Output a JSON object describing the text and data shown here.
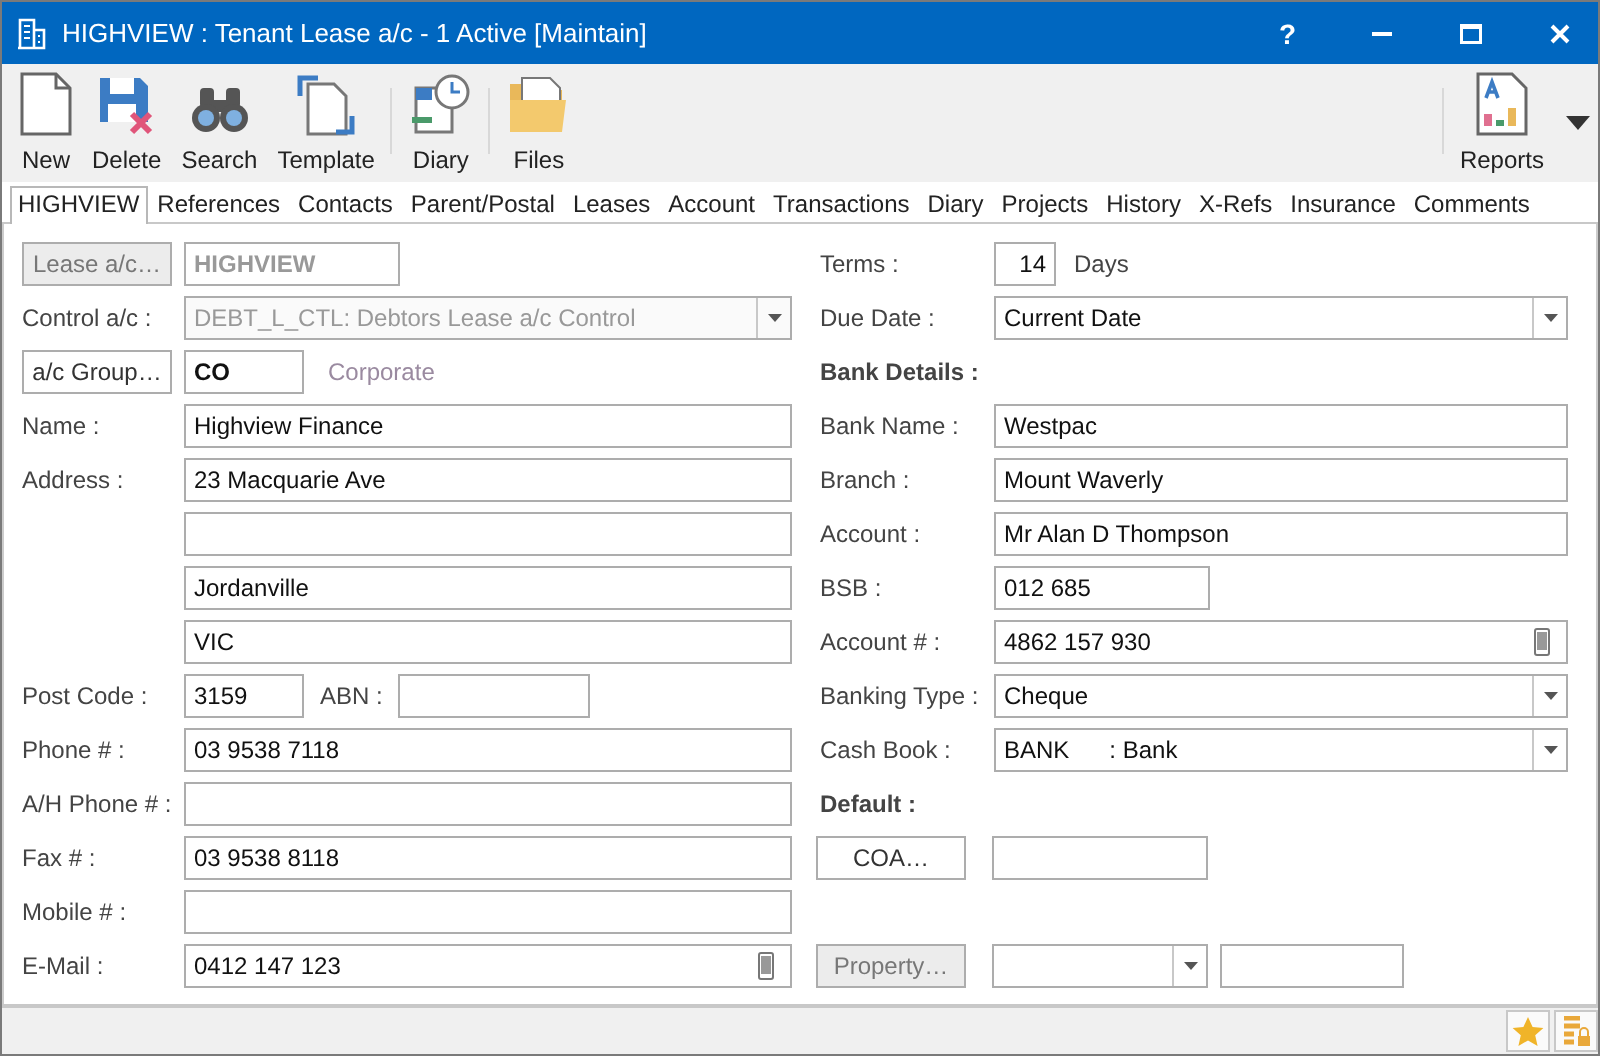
{
  "window": {
    "title": "HIGHVIEW : Tenant Lease a/c - 1 Active [Maintain]",
    "help": "?"
  },
  "toolbar": {
    "groups": [
      [
        {
          "label": "New",
          "kind": "new"
        },
        {
          "label": "Delete",
          "kind": "delete"
        },
        {
          "label": "Search",
          "kind": "search"
        },
        {
          "label": "Template",
          "kind": "template"
        }
      ],
      [
        {
          "label": "Diary",
          "kind": "diary"
        }
      ],
      [
        {
          "label": "Files",
          "kind": "files"
        }
      ]
    ],
    "right": [
      {
        "label": "Reports",
        "kind": "reports"
      }
    ]
  },
  "tabs": [
    {
      "label": "HIGHVIEW",
      "selected": true
    },
    {
      "label": "References",
      "selected": false
    },
    {
      "label": "Contacts",
      "selected": false
    },
    {
      "label": "Parent/Postal",
      "selected": false
    },
    {
      "label": "Leases",
      "selected": false
    },
    {
      "label": "Account",
      "selected": false
    },
    {
      "label": "Transactions",
      "selected": false
    },
    {
      "label": "Diary",
      "selected": false
    },
    {
      "label": "Projects",
      "selected": false
    },
    {
      "label": "History",
      "selected": false
    },
    {
      "label": "X-Refs",
      "selected": false
    },
    {
      "label": "Insurance",
      "selected": false
    },
    {
      "label": "Comments",
      "selected": false
    }
  ],
  "left_rows": [
    {
      "kind": "button_field",
      "button": "Lease a/c…",
      "value": "HIGHVIEW",
      "disabled": true
    },
    {
      "kind": "select",
      "label": "Control a/c :",
      "value": "DEBT_L_CTL: Debtors Lease a/c Control",
      "disabled": true
    },
    {
      "kind": "button_field",
      "button": "a/c Group…",
      "value": "CO",
      "note": "Corporate",
      "disabled": false
    },
    {
      "kind": "field",
      "label": "Name :",
      "value": "Highview Finance"
    },
    {
      "kind": "field",
      "label": "Address :",
      "value": "23 Macquarie Ave"
    },
    {
      "kind": "field"
    },
    {
      "kind": "field",
      "value": "Jordanville"
    },
    {
      "kind": "field",
      "value": "VIC"
    },
    {
      "kind": "pair",
      "label": "Post Code :",
      "value": "3159",
      "label_2": "ABN :"
    },
    {
      "kind": "field",
      "label": "Phone # :",
      "value": "03 9538 7118"
    },
    {
      "kind": "field",
      "label": "A/H Phone # :"
    },
    {
      "kind": "field",
      "label": "Fax # :",
      "value": "03 9538 8118"
    },
    {
      "kind": "field",
      "label": "Mobile # :"
    },
    {
      "kind": "field",
      "label": "E-Mail :",
      "value": "0412 147 123",
      "phone_icon": true
    }
  ],
  "right_rows": [
    {
      "kind": "terms",
      "label": "Terms :",
      "value": "14",
      "unit": "Days"
    },
    {
      "kind": "select",
      "label": "Due Date :",
      "value": "Current Date",
      "disabled": false
    },
    {
      "kind": "heading",
      "label": "Bank Details :"
    },
    {
      "kind": "field",
      "label": "Bank Name :",
      "value": "Westpac"
    },
    {
      "kind": "field",
      "label": "Branch :",
      "value": "Mount Waverly"
    },
    {
      "kind": "field",
      "label": "Account :",
      "value": "Mr Alan D Thompson"
    },
    {
      "kind": "short_field",
      "label": "BSB :",
      "value": "012 685"
    },
    {
      "kind": "field",
      "label": "Account # :",
      "value": "4862 157 930",
      "phone_icon": true
    },
    {
      "kind": "select",
      "label": "Banking Type :",
      "value": "Cheque",
      "disabled": false
    },
    {
      "kind": "select",
      "label": "Cash Book :",
      "value": "BANK      : Bank",
      "disabled": false
    },
    {
      "kind": "heading",
      "label": "Default :"
    },
    {
      "kind": "button_field",
      "button": "COA…",
      "disabled": false
    },
    {
      "kind": "empty"
    },
    {
      "kind": "property",
      "button": "Property…",
      "disabled": true
    }
  ]
}
